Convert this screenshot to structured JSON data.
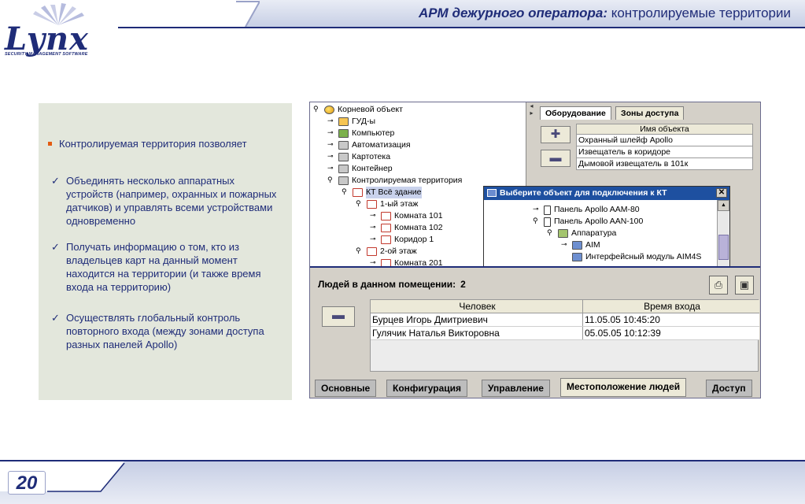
{
  "header": {
    "title_bold": "АРМ дежурного оператора:",
    "title_rest": " контролируемые территории",
    "logo_word": "Lynx",
    "logo_sub": "SECURITY MANAGEMENT SOFTWARE"
  },
  "textpanel": {
    "bullet": "Контролируемая территория позволяет",
    "checks": [
      "Объединять несколько аппаратных устройств (например, охранных и пожарных датчиков) и управлять всеми устройствами одновременно",
      "Получать информацию о том, кто из владельцев карт на данный момент находится на территории (и также время входа на территорию)",
      "Осуществлять глобальный контроль повторного входа (между зонами доступа разных панелей Apollo)"
    ]
  },
  "tree": {
    "items": [
      {
        "label": "Корневой объект",
        "toggle": "⚲",
        "icon": "globe-icon"
      },
      {
        "label": "ГУД-ы",
        "toggle": "⊸",
        "icon": "gud-icon"
      },
      {
        "label": "Компьютер",
        "toggle": "⊸",
        "icon": "computer-icon"
      },
      {
        "label": "Автоматизация",
        "toggle": "⊸",
        "icon": "cabinet-icon"
      },
      {
        "label": "Картотека",
        "toggle": "⊸",
        "icon": "cabinet-icon"
      },
      {
        "label": "Контейнер",
        "toggle": "⊸",
        "icon": "cabinet-icon"
      },
      {
        "label": "Контролируемая территория",
        "toggle": "⚲",
        "icon": "cabinet-icon"
      },
      {
        "label": "КТ Всё здание",
        "toggle": "⚲",
        "icon": "room-icon"
      },
      {
        "label": "1-ый этаж",
        "toggle": "⚲",
        "icon": "room-icon"
      },
      {
        "label": "Комната 101",
        "toggle": "⊸",
        "icon": "room-icon"
      },
      {
        "label": "Комната 102",
        "toggle": "⊸",
        "icon": "room-icon"
      },
      {
        "label": "Коридор 1",
        "toggle": "⊸",
        "icon": "room-icon"
      },
      {
        "label": "2-ой этаж",
        "toggle": "⚲",
        "icon": "room-icon"
      },
      {
        "label": "Комната 201",
        "toggle": "⊸",
        "icon": "room-icon"
      }
    ]
  },
  "right_pane": {
    "tab_equipment": "Оборудование",
    "tab_zones": "Зоны доступа",
    "add_symbol": "✚",
    "remove_symbol": "▬",
    "grid_header": "Имя объекта",
    "grid_rows": [
      "Охранный шлейф Apollo",
      "Извещатель в коридоре",
      "Дымовой извещатель в 101к"
    ]
  },
  "dialog": {
    "title": "Выберите объект для подключения к КТ",
    "close": "✕",
    "items": [
      {
        "label": "Панель Apollo AAM-80",
        "toggle": "⊸",
        "icon": "panel-icon"
      },
      {
        "label": "Панель Apollo AAN-100",
        "toggle": "⚲",
        "icon": "panel-icon"
      },
      {
        "label": "Аппаратура",
        "toggle": "⚲",
        "icon": "hardware-icon"
      },
      {
        "label": "AIM",
        "toggle": "⊸",
        "icon": "aim-icon"
      },
      {
        "label": "Интерфейсный модуль AIM4S",
        "toggle": "",
        "icon": "aim-icon"
      }
    ]
  },
  "lower": {
    "people_label": "Людей в данном помещении:",
    "people_count": "2",
    "remove_symbol": "▬",
    "col_person": "Человек",
    "col_time": "Время входа",
    "rows": [
      {
        "person": "Бурцев Игорь Дмитриевич",
        "time": "11.05.05 10:45:20"
      },
      {
        "person": "Гулячик Наталья  Викторовна",
        "time": "05.05.05 10:12:39"
      }
    ]
  },
  "bottom_tabs": [
    "Основные",
    "Конфигурация",
    "Управление",
    "Местоположение людей",
    "Доступ"
  ],
  "footer": {
    "page_number": "20"
  }
}
